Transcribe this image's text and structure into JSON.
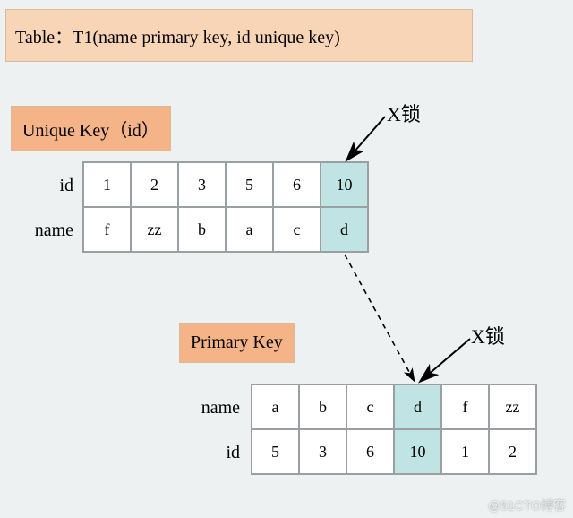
{
  "title": "Table：T1(name primary key, id unique key)",
  "uniqueKey": {
    "label": "Unique Key（id）",
    "lockLabel": "X锁",
    "rows": {
      "id": {
        "label": "id",
        "values": [
          "1",
          "2",
          "3",
          "5",
          "6",
          "10"
        ],
        "highlight": 5
      },
      "name": {
        "label": "name",
        "values": [
          "f",
          "zz",
          "b",
          "a",
          "c",
          "d"
        ],
        "highlight": 5
      }
    }
  },
  "primaryKey": {
    "label": "Primary Key",
    "lockLabel": "X锁",
    "rows": {
      "name": {
        "label": "name",
        "values": [
          "a",
          "b",
          "c",
          "d",
          "f",
          "zz"
        ],
        "highlight": 3
      },
      "id": {
        "label": "id",
        "values": [
          "5",
          "3",
          "6",
          "10",
          "1",
          "2"
        ],
        "highlight": 3
      }
    }
  },
  "watermark": "@51CTO博客"
}
